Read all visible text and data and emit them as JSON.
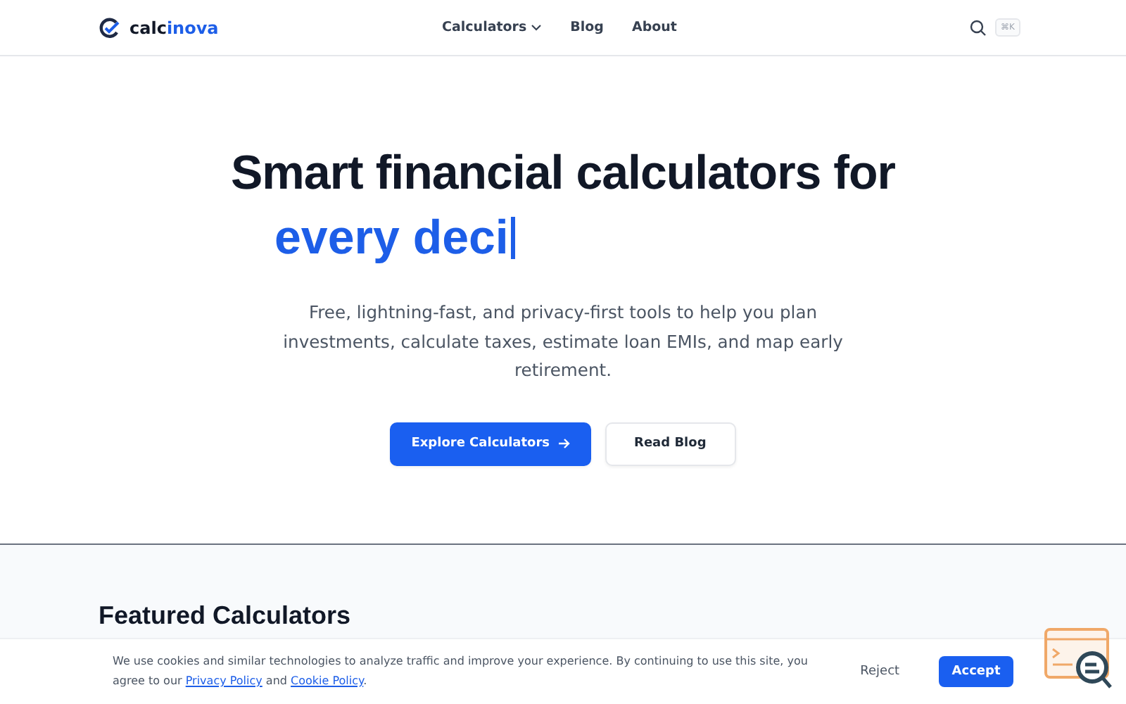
{
  "nav": {
    "brand": [
      {
        "text": "calc",
        "accent": false
      },
      {
        "text": "inova",
        "accent": true
      }
    ],
    "links": [
      {
        "label": "Calculators",
        "dropdown": true
      },
      {
        "label": "Blog",
        "dropdown": false
      },
      {
        "label": "About",
        "dropdown": false
      }
    ],
    "shortcut": "⌘K"
  },
  "hero": {
    "title": "Smart financial calculators for",
    "typed": "every deci",
    "subtitle": "Free, lightning-fast, and privacy-first tools to help you plan investments, calculate taxes, estimate loan EMIs, and map early retirement.",
    "buttons": [
      {
        "label": "Explore Calculators",
        "kind": "primary"
      },
      {
        "label": "Read Blog",
        "kind": "secondary"
      }
    ]
  },
  "featured": {
    "heading": "Featured Calculators"
  },
  "cookie": {
    "text_before": "We use cookies and similar technologies to analyze traffic and improve your experience. By continuing to use this site, you agree to our ",
    "links": [
      "Privacy Policy",
      "Cookie Policy"
    ],
    "joiner": " and ",
    "end": ".",
    "reject": "Reject",
    "accept": "Accept"
  }
}
